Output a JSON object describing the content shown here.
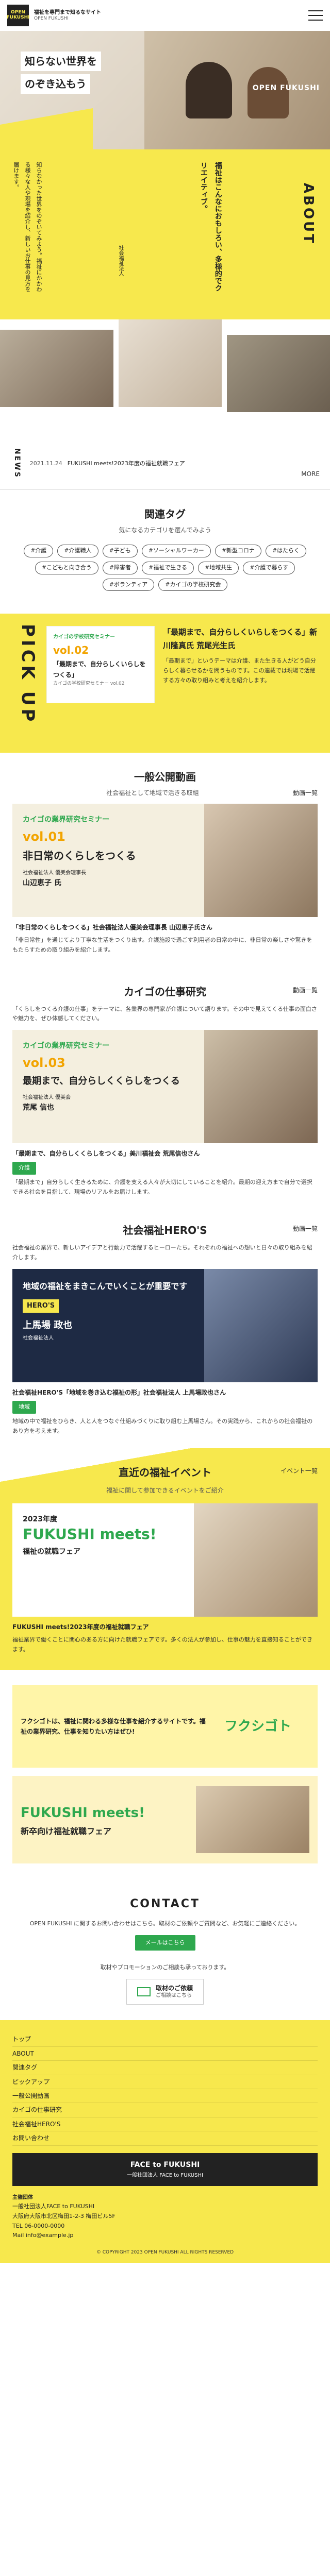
{
  "header": {
    "logo_top": "OPEN",
    "logo_bottom": "FUKUSHI",
    "tagline": "福祉を専門まで知るなサイト",
    "tagline_sub": "OPEN FUKUSHI",
    "menu_icon": "hamburger-icon"
  },
  "hero": {
    "catch_line1": "知らない世界を",
    "catch_line2": "のぞき込もう",
    "brand": "OPEN FUKUSHI",
    "vertical_copy": "福祉はこんなにおもしろい!専門的でクリエイティブ",
    "about_label": "ABOUT",
    "about_title": "福祉はこんなにおもしろい、多様的でクリエイティブ。",
    "about_text": "知らなかった世界をのぞいてみよう。福祉にかかわる様々な人や現場を紹介し、新しいお仕事の見方を届けます。",
    "about_signature": "社会福祉法人"
  },
  "news": {
    "label": "NEWS",
    "date": "2021.11.24",
    "headline": "FUKUSHI meets!2023年度の福祉就職フェア",
    "more": "MORE"
  },
  "tags": {
    "title": "関連タグ",
    "subtitle": "気になるカテゴリを選んでみよう",
    "items": [
      "#介護",
      "#介護職人",
      "#子ども",
      "#ソーシャルワーカー",
      "#新型コロナ",
      "#はたらく",
      "#こどもと向き合う",
      "#障害者",
      "#福祉で生きる",
      "#地域共生",
      "#介護で暮らす",
      "#ボランティア",
      "#カイゴの学校研究会"
    ]
  },
  "pickup": {
    "label": "PICK UP",
    "badge": "カイゴの学校研究セミナー",
    "vol": "vol.02",
    "card_title": "「最期まで、自分らしくいらしをつくる」",
    "card_sub": "カイゴの学校研究セミナー vol.02",
    "article_title": "「最期まで、自分らしくいらしをつくる」新川隆真氏 荒尾光生氏",
    "article_text": "「最期まで」というテーマは介護、また生きる人がどう自分らしく暮らせるかを問うものです。この連載では現場で活躍する方々の取り組みと考えを紹介します。"
  },
  "general": {
    "title": "一般公開動画",
    "subtitle": "社会福祉として地域で活きる取組",
    "more": "動画一覧",
    "card_head": "カイゴの業界研究セミナー",
    "vol": "vol.01",
    "card_title": "非日常のくらしをつくる",
    "speaker_role": "社会福祉法人 優美会理事長",
    "speaker_name": "山辺恵子 氏",
    "caption": "「非日常のくらしをつくる」社会福祉法人優美会理事長 山辺恵子氏さん",
    "body": "「非日常性」を通じてより丁寧な生活をつくり出す。介護施設で過ごす利用者の日常の中に、非日常の楽しさや驚きをもたらすための取り組みを紹介します。"
  },
  "research": {
    "title": "カイゴの仕事研究",
    "more": "動画一覧",
    "intro": "「くらしをつくる介護の仕事」をテーマに、各業界の専門家が介護について語ります。その中で見えてくる仕事の面白さや魅力を、ぜひ体感してください。",
    "card_head": "カイゴの業界研究セミナー",
    "vol": "vol.03",
    "card_title": "最期まで、自分らしくくらしをつくる",
    "speaker_role": "社会福祉法人 優美会",
    "speaker_name": "荒尾 信也",
    "caption": "「最期まで、自分らしくくらしをつくる」美川福祉会 荒尾信也さん",
    "badge": "介護",
    "body": "「最期まで」自分らしく生きるために、介護を支える人々が大切にしていることを紹介。最期の迎え方まで自分で選択できる社会を目指して、現場のリアルをお届けします。"
  },
  "heros": {
    "title": "社会福祉HERO'S",
    "more": "動画一覧",
    "intro": "社会福祉の業界で、新しいアイデアと行動力で活躍するヒーローたち。それぞれの福祉への想いと日々の取り組みを紹介します。",
    "card_copy": "地域の福祉をまきこんでいくことが重要です",
    "card_brand": "HERO'S",
    "speaker_name": "上馬場 政也",
    "speaker_role": "社会福祉法人",
    "caption": "社会福祉HERO'S「地域を巻き込む福祉の形」社会福祉法人 上馬場政也さん",
    "badge": "地域",
    "body": "地域の中で福祉をひらき、人と人をつなぐ仕組みづくりに取り組む上馬場さん。その実践から、これからの社会福祉のあり方を考えます。"
  },
  "event": {
    "title": "直近の福祉イベント",
    "more": "イベント一覧",
    "subtitle": "福祉に関して参加できるイベントをご紹介",
    "flyer_year": "2023年度",
    "flyer_title": "FUKUSHI meets!",
    "flyer_sub": "福祉の就職フェア",
    "caption": "FUKUSHI meets!2023年度の福祉就職フェア",
    "body": "福祉業界で働くことに関心のある方に向けた就職フェアです。多くの法人が参加し、仕事の魅力を直接知ることができます。"
  },
  "banners": {
    "fuku_text": "フクシゴトは、福祉に関わる多様な仕事を紹介するサイトです。福祉の業界研究、仕事を知りたい方はぜひ!",
    "fuku_title": "フクシゴト",
    "meets_title": "FUKUSHI meets!",
    "meets_sub": "新卒向け福祉就職フェア"
  },
  "contact": {
    "title": "CONTACT",
    "text": "OPEN FUKUSHI に関するお問い合わせはこちら。取材のご依頼やご質問など、お気軽にご連絡ください。",
    "mail_button": "メールはこちら",
    "text2": "取材やプロモーションのご相談も承っております。",
    "banner_title": "取材のご依頼",
    "banner_sub": "ご相談はこちら"
  },
  "footer": {
    "links": [
      "トップ",
      "ABOUT",
      "関連タグ",
      "ピックアップ",
      "一般公開動画",
      "カイゴの仕事研究",
      "社会福祉HERO'S",
      "お問い合わせ"
    ],
    "logo_title": "FACE to FUKUSHI",
    "logo_sub": "一般社団法人 FACE to FUKUSHI",
    "org_label": "主催団体",
    "org_name": "一般社団法人FACE to FUKUSHI",
    "address": "大阪府大阪市北区梅田1-2-3 梅田ビル5F",
    "tel": "TEL 06-0000-0000",
    "mail": "Mail info@example.jp",
    "copyright": "© COPYRIGHT 2023 OPEN FUKUSHI ALL RIGHTS RESERVED"
  },
  "colors": {
    "accent": "#f7e84d",
    "green": "#2ea84e",
    "dark": "#222222"
  }
}
